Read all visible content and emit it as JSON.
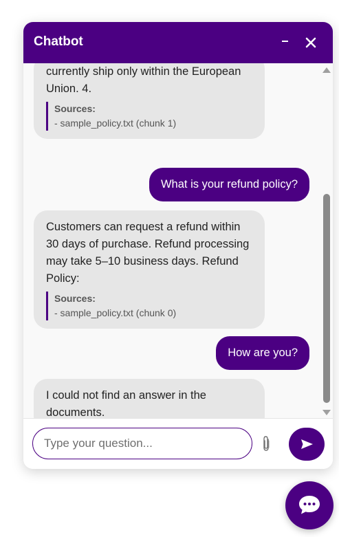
{
  "header": {
    "title": "Chatbot",
    "minimize_icon": "minimize-icon",
    "close_icon": "close-icon"
  },
  "messages": [
    {
      "role": "bot",
      "text": "currently ship only within the European Union. 4.",
      "sources_title": "Sources:",
      "source": "- sample_policy.txt (chunk 1)"
    },
    {
      "role": "user",
      "text": "What is your refund policy?"
    },
    {
      "role": "bot",
      "text": "Customers can request a refund within 30 days of purchase. Refund processing may take 5–10 business days. Refund Policy:",
      "sources_title": "Sources:",
      "source": "- sample_policy.txt (chunk 0)"
    },
    {
      "role": "user",
      "text": "How are you?"
    },
    {
      "role": "bot",
      "text": "I could not find an answer in the documents."
    }
  ],
  "input": {
    "placeholder": "Type your question...",
    "value": ""
  },
  "colors": {
    "accent": "#4b0082",
    "bot_bubble": "#e6e6e6",
    "messages_bg": "#f9f9f9"
  },
  "icons": {
    "attach": "paperclip-icon",
    "send": "send-arrow-icon",
    "launcher": "chat-bubble-icon"
  }
}
